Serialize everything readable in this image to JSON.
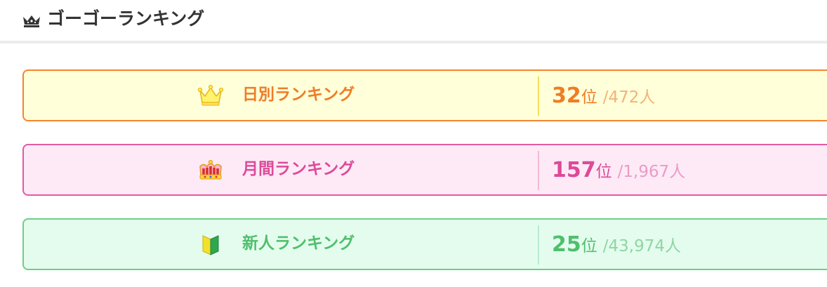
{
  "header": {
    "icon": "crown-icon",
    "title": "ゴーゴーランキング"
  },
  "rankings": {
    "daily": {
      "icon": "gold-crown-icon",
      "label": "日別ランキング",
      "rank": "32",
      "unit": "位",
      "total": "/472人",
      "colors": {
        "accent": "#ee7d27",
        "border": "#f3862f",
        "background": "#ffffd9"
      }
    },
    "monthly": {
      "icon": "jeweled-crown-icon",
      "label": "月間ランキング",
      "rank": "157",
      "unit": "位",
      "total": "/1,967人",
      "colors": {
        "accent": "#dd4a99",
        "border": "#e35aa5",
        "background": "#fdeaf6"
      }
    },
    "new": {
      "icon": "beginner-mark-icon",
      "label": "新人ランキング",
      "rank": "25",
      "unit": "位",
      "total": "/43,974人",
      "colors": {
        "accent": "#4fbf6c",
        "border": "#6ccf84",
        "background": "#e4fcee"
      }
    }
  }
}
